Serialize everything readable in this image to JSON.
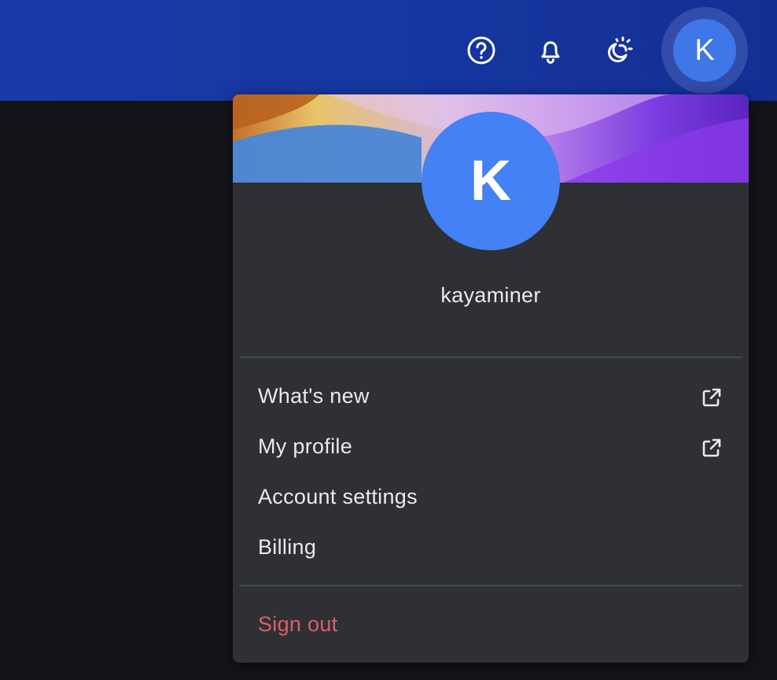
{
  "header": {
    "icons": [
      "help-circle-icon",
      "bell-icon",
      "theme-toggle-icon"
    ],
    "avatar_initial": "K"
  },
  "profile_menu": {
    "avatar_initial": "K",
    "username": "kayaminer",
    "items": [
      {
        "label": "What's new",
        "external": true
      },
      {
        "label": "My profile",
        "external": true
      },
      {
        "label": "Account settings",
        "external": false
      },
      {
        "label": "Billing",
        "external": false
      }
    ],
    "sign_out_label": "Sign out"
  },
  "colors": {
    "header_bg": "#1636a0",
    "avatar": "#4481f4",
    "menu_bg": "#2e3035",
    "page_bg": "#121419",
    "sign_out": "#d9606a"
  }
}
